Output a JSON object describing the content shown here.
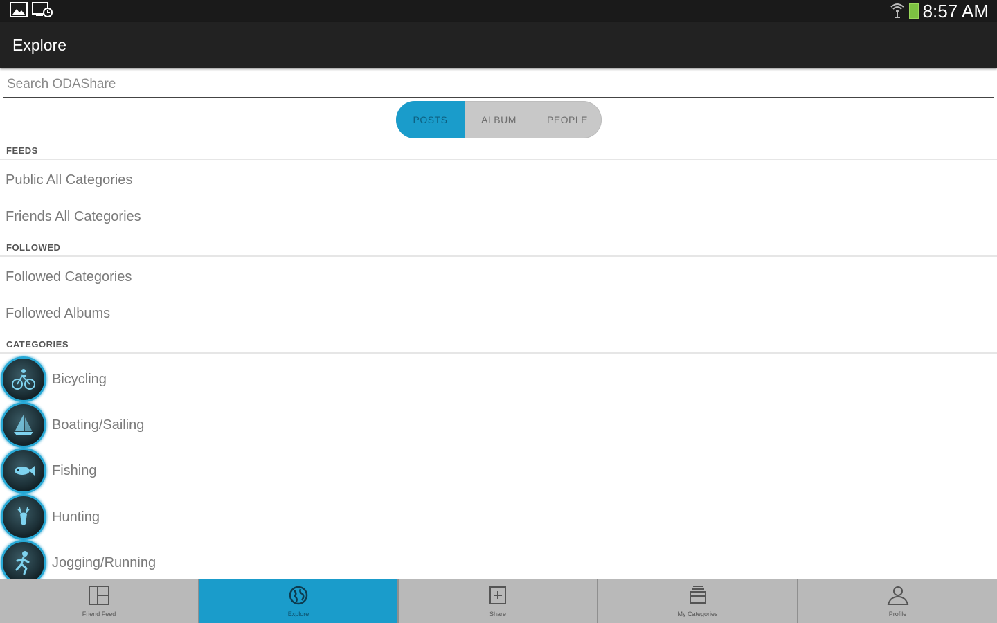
{
  "status_bar": {
    "time": "8:57 AM",
    "left_icons": [
      "gallery-icon",
      "screen-rotation-icon"
    ],
    "right_icons": [
      "wifi-icon",
      "battery-icon"
    ]
  },
  "action_bar": {
    "title": "Explore"
  },
  "search": {
    "placeholder": "Search ODAShare"
  },
  "segments": [
    {
      "label": "POSTS",
      "active": true
    },
    {
      "label": "ALBUM",
      "active": false
    },
    {
      "label": "PEOPLE",
      "active": false
    }
  ],
  "sections": {
    "feeds": {
      "header": "FEEDS",
      "items": [
        "Public All Categories",
        "Friends All Categories"
      ]
    },
    "followed": {
      "header": "FOLLOWED",
      "items": [
        "Followed Categories",
        "Followed Albums"
      ]
    },
    "categories": {
      "header": "CATEGORIES",
      "items": [
        {
          "label": "Bicycling",
          "icon": "bicycle-icon"
        },
        {
          "label": "Boating/Sailing",
          "icon": "boat-icon"
        },
        {
          "label": "Fishing",
          "icon": "fish-icon"
        },
        {
          "label": "Hunting",
          "icon": "deer-icon"
        },
        {
          "label": "Jogging/Running",
          "icon": "runner-icon"
        }
      ]
    }
  },
  "bottom_nav": [
    {
      "label": "Friend Feed",
      "icon": "grid-layout-icon",
      "active": false
    },
    {
      "label": "Explore",
      "icon": "globe-icon",
      "active": true
    },
    {
      "label": "Share",
      "icon": "add-post-icon",
      "active": false
    },
    {
      "label": "My Categories",
      "icon": "stack-icon",
      "active": false
    },
    {
      "label": "Profile",
      "icon": "person-icon",
      "active": false
    }
  ],
  "colors": {
    "accent": "#1a9ccb",
    "action_bar": "#222222",
    "bottom_nav": "#b9b9b9"
  }
}
